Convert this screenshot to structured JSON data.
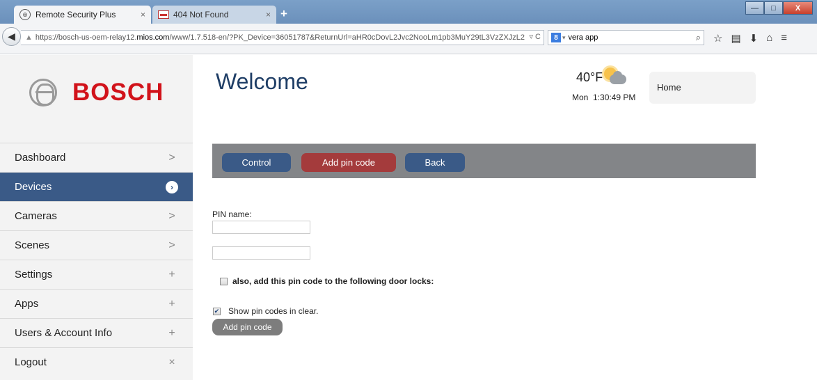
{
  "browser": {
    "tabs": [
      {
        "title": "Remote Security Plus",
        "close": "×"
      },
      {
        "title": "404 Not Found",
        "close": "×"
      }
    ],
    "new_tab": "+",
    "window_controls": {
      "minimize": "—",
      "maximize": "□",
      "close": "X"
    },
    "url": {
      "prefix": "https://bosch-us-oem-relay12.",
      "host": "mios.com",
      "path": "/www/1.7.518-en/?PK_Device=36051787&ReturnUrl=aHR0cDovL2Jvc2NooLm1pb3MuY29tL3VzZXJzL2"
    },
    "search": {
      "engine_icon": "8",
      "value": "vera app"
    }
  },
  "brand": {
    "name": "BOSCH",
    "color": "#d1121a"
  },
  "sidebar": {
    "items": [
      {
        "label": "Dashboard",
        "icon": "chevron-right-icon",
        "glyph": ">"
      },
      {
        "label": "Devices",
        "icon": "chevron-right-circle-icon",
        "glyph": "›",
        "active": true
      },
      {
        "label": "Cameras",
        "icon": "chevron-right-icon",
        "glyph": ">"
      },
      {
        "label": "Scenes",
        "icon": "chevron-right-icon",
        "glyph": ">"
      },
      {
        "label": "Settings",
        "icon": "plus-icon",
        "glyph": "+"
      },
      {
        "label": "Apps",
        "icon": "plus-icon",
        "glyph": "+"
      },
      {
        "label": "Users & Account Info",
        "icon": "plus-icon",
        "glyph": "+"
      },
      {
        "label": "Logout",
        "icon": "close-icon",
        "glyph": "×"
      }
    ]
  },
  "header": {
    "welcome": "Welcome",
    "temperature": "40°F",
    "weather_icon": "partly-cloudy-icon",
    "day": "Mon",
    "time": "1:30:49 PM",
    "location": "Home"
  },
  "toolbar": {
    "control_label": "Control",
    "add_pin_label": "Add pin code",
    "back_label": "Back"
  },
  "form": {
    "pin_name_label": "PIN name:",
    "pin_name_value": "",
    "pin_code_value": "",
    "door_locks_label": "also, add this pin code to the following door locks:",
    "door_locks_checked": false,
    "show_clear_label": "Show pin codes in clear.",
    "show_clear_checked": true,
    "submit_label": "Add pin code"
  },
  "colors": {
    "nav_active": "#3a5a87",
    "add_pin_button": "#a43b3c",
    "toolbar_bg": "#838588"
  }
}
